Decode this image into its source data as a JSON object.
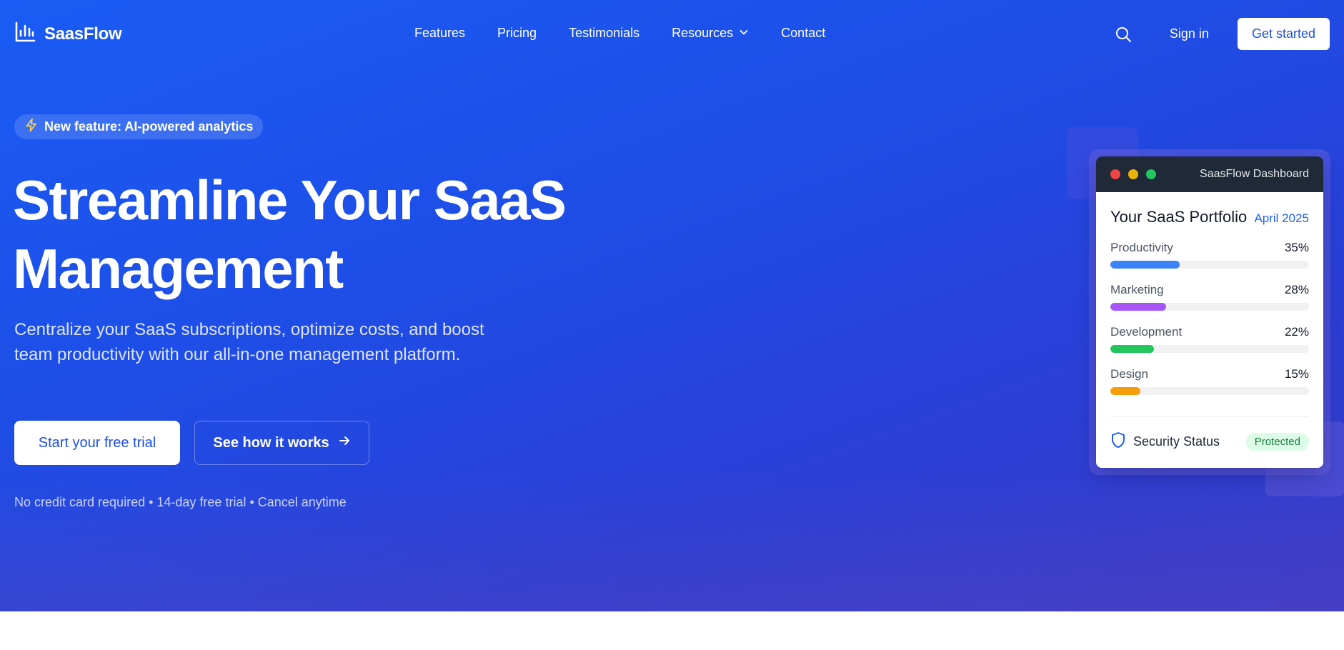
{
  "brand": {
    "name": "SaasFlow",
    "logo_icon": "bar-chart-icon"
  },
  "nav": {
    "links": [
      {
        "label": "Features"
      },
      {
        "label": "Pricing"
      },
      {
        "label": "Testimonials"
      },
      {
        "label": "Resources",
        "has_dropdown": true
      },
      {
        "label": "Contact"
      }
    ],
    "search_icon": "search-icon",
    "sign_in": "Sign in",
    "get_started": "Get started"
  },
  "hero": {
    "badge": "New feature: AI-powered analytics",
    "badge_icon": "lightning-icon",
    "headline_line1": "Streamline Your SaaS",
    "headline_line2": "Management",
    "subtext": "Centralize your SaaS subscriptions, optimize costs, and boost team productivity with our all-in-one management platform.",
    "cta_primary": "Start your free trial",
    "cta_secondary": "See how it works",
    "fineprint": "No credit card required • 14-day free trial • Cancel anytime"
  },
  "dashboard": {
    "window_title": "SaasFlow Dashboard",
    "title": "Your SaaS Portfolio",
    "date": "April 2025",
    "categories": [
      {
        "name": "Productivity",
        "pct_label": "35%",
        "pct": 35,
        "color": "#3b82f6"
      },
      {
        "name": "Marketing",
        "pct_label": "28%",
        "pct": 28,
        "color": "#a855f7"
      },
      {
        "name": "Development",
        "pct_label": "22%",
        "pct": 22,
        "color": "#22c55e"
      },
      {
        "name": "Design",
        "pct_label": "15%",
        "pct": 15,
        "color": "#f59e0b"
      }
    ],
    "security_label": "Security Status",
    "security_status": "Protected"
  },
  "colors": {
    "accent": "#1d4fe8",
    "hero_bg": "#1a5cf5"
  }
}
